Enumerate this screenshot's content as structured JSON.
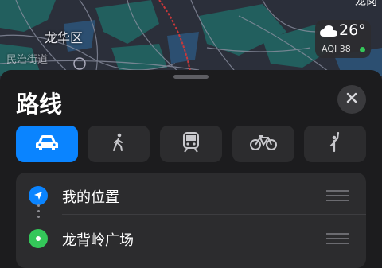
{
  "map": {
    "district_label": "龙华区",
    "corner_label": "龙岗",
    "partial_label": "民治街道"
  },
  "weather": {
    "temperature": "26°",
    "aqi": "AQI 38",
    "icon": "cloud-icon",
    "aqi_color": "#34c759"
  },
  "sheet": {
    "title": "路线",
    "close_icon": "close-icon",
    "transport_modes": [
      {
        "name": "drive",
        "icon": "car-icon",
        "selected": true
      },
      {
        "name": "walk",
        "icon": "walk-icon",
        "selected": false
      },
      {
        "name": "transit",
        "icon": "train-icon",
        "selected": false
      },
      {
        "name": "cycle",
        "icon": "bicycle-icon",
        "selected": false
      },
      {
        "name": "rideshare",
        "icon": "hail-icon",
        "selected": false
      }
    ],
    "stops": [
      {
        "label": "我的位置",
        "icon": "location-arrow-icon",
        "color": "#0a84ff"
      },
      {
        "label": "龙背岭广场",
        "icon": "destination-pin-icon",
        "color": "#34c759"
      }
    ]
  },
  "colors": {
    "accent": "#0a84ff",
    "background": "#1c1c1e",
    "card": "#2c2c2e"
  }
}
